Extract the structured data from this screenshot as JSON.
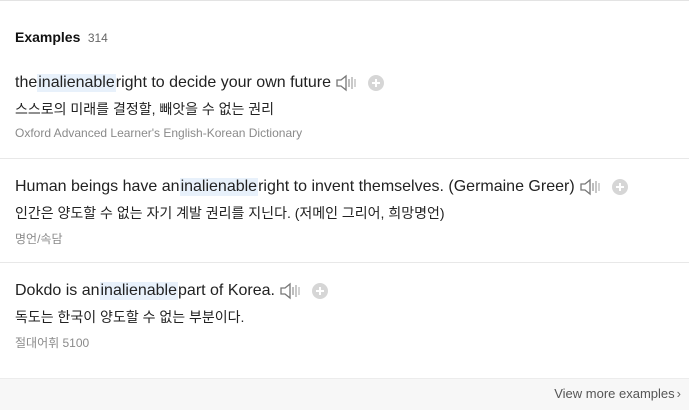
{
  "header": {
    "title": "Examples",
    "count": "314"
  },
  "examples": [
    {
      "en_before": "the ",
      "en_highlight": "inalienable",
      "en_after": " right to decide your own future",
      "ko": "스스로의 미래를 결정할, 빼앗을 수 없는 권리",
      "source": "Oxford Advanced Learner's English-Korean Dictionary"
    },
    {
      "en_before": "Human beings have an ",
      "en_highlight": "inalienable",
      "en_after": " right to invent themselves. (Germaine Greer)",
      "ko": "인간은 양도할 수 없는 자기 계발 권리를 지닌다. (저메인 그리어, 희망명언)",
      "source": "명언/속담"
    },
    {
      "en_before": "Dokdo is an ",
      "en_highlight": "inalienable",
      "en_after": " part of Korea.",
      "ko": "독도는 한국이 양도할 수 없는 부분이다.",
      "source": "절대어휘 5100"
    }
  ],
  "footer": {
    "view_more_label": "View more examples",
    "chevron_icon": "chevron-right-icon"
  },
  "icons": {
    "speaker": "speaker-icon",
    "add": "plus-circle-icon"
  },
  "colors": {
    "highlight": "#e8f1fb",
    "source_text": "#8a8a8a"
  }
}
